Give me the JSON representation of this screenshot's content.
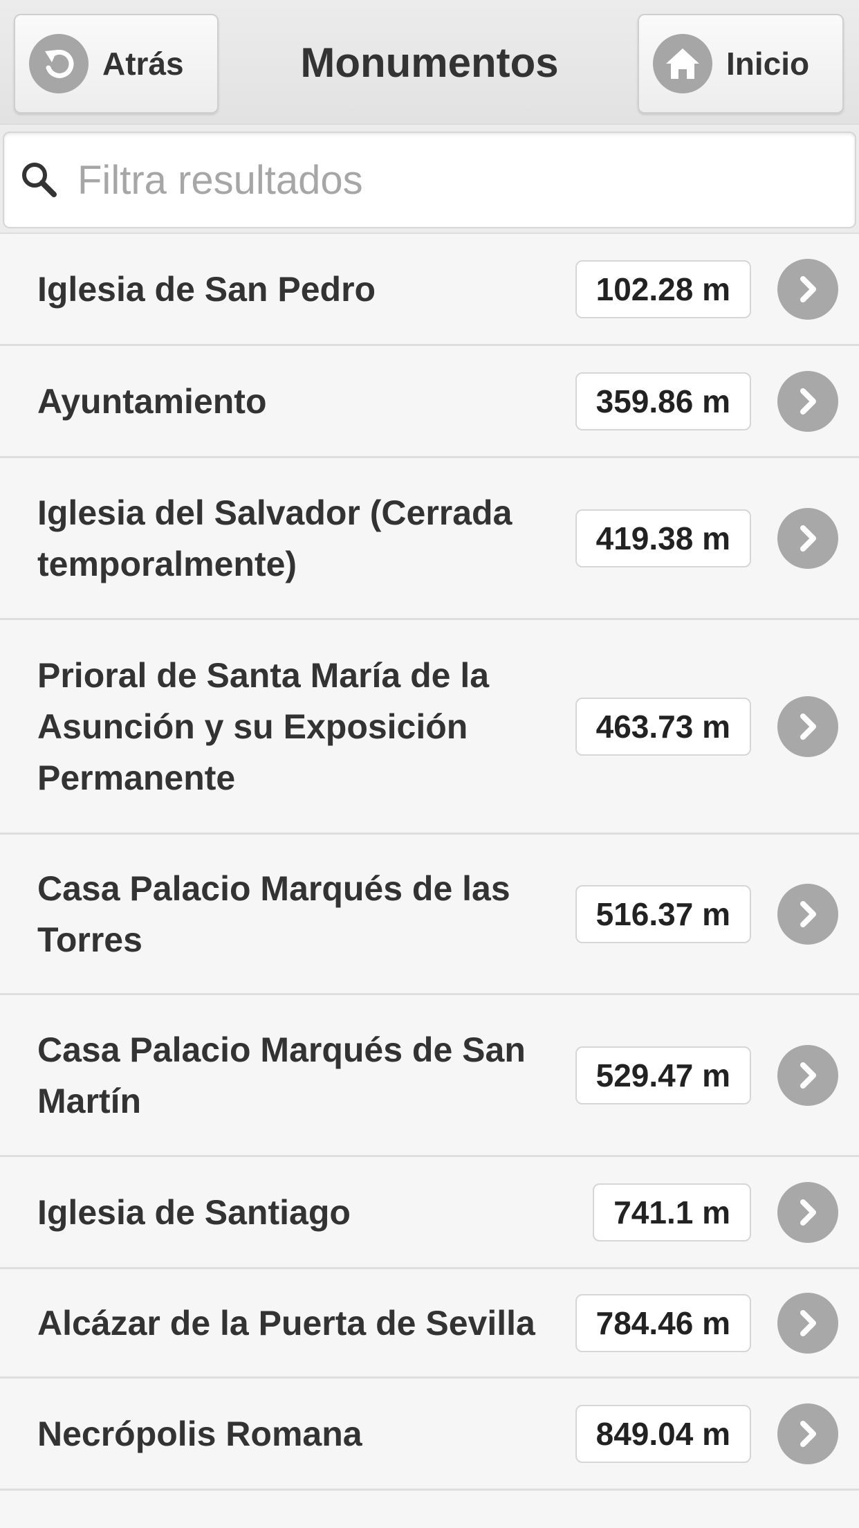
{
  "header": {
    "back_label": "Atrás",
    "title": "Monumentos",
    "home_label": "Inicio"
  },
  "search": {
    "placeholder": "Filtra resultados",
    "value": ""
  },
  "items": [
    {
      "name": "Iglesia de San Pedro",
      "distance": "102.28 m"
    },
    {
      "name": "Ayuntamiento",
      "distance": "359.86 m"
    },
    {
      "name": "Iglesia del Salvador (Cerrada temporalmente)",
      "distance": "419.38 m"
    },
    {
      "name": "Prioral de Santa María de la Asunción y su Exposición Permanente",
      "distance": "463.73 m"
    },
    {
      "name": "Casa Palacio Marqués de las Torres",
      "distance": "516.37 m"
    },
    {
      "name": "Casa Palacio Marqués de San Martín",
      "distance": "529.47 m"
    },
    {
      "name": "Iglesia de Santiago",
      "distance": "741.1 m"
    },
    {
      "name": "Alcázar de la Puerta de Sevilla",
      "distance": "784.46 m"
    },
    {
      "name": "Necrópolis Romana",
      "distance": "849.04 m"
    }
  ],
  "icons": {
    "back": "back-arrow-icon",
    "home": "home-icon",
    "search": "search-icon",
    "row_arrow": "chevron-right-icon"
  }
}
